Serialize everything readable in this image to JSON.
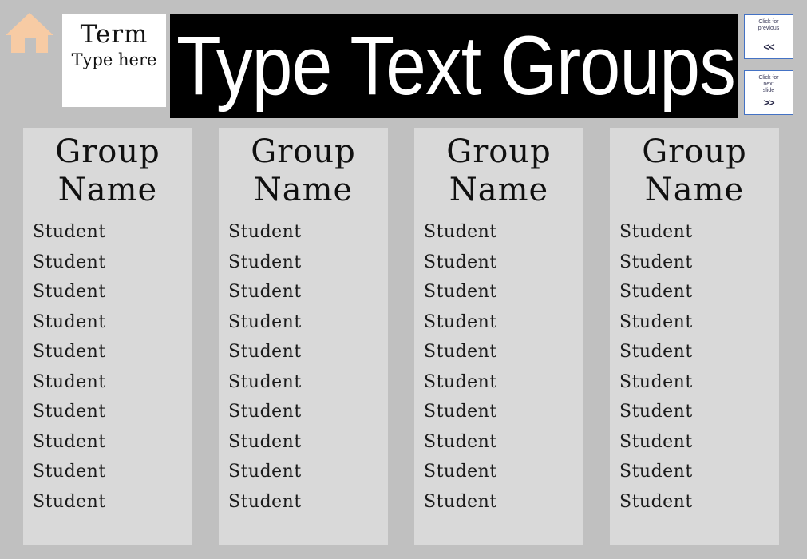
{
  "page": {
    "background_color": "#c0c0c0",
    "panel_color": "#d9d9d9"
  },
  "header": {
    "home_icon": "home-icon",
    "home_icon_color": "#f7cba4",
    "term_box": {
      "title": "Term",
      "hint": "Type\nhere"
    },
    "title": "Type Text Groups",
    "title_background": "#000000",
    "title_color": "#ffffff"
  },
  "nav": {
    "border_color": "#4472c4",
    "buttons": [
      {
        "name": "previous",
        "label": "Click for\nprevious",
        "arrow": "<<"
      },
      {
        "name": "next",
        "label": "Click for\nnext\nslide",
        "arrow": ">>"
      }
    ]
  },
  "groups": [
    {
      "name": "Group\nName",
      "students": [
        "Student",
        "Student",
        "Student",
        "Student",
        "Student",
        "Student",
        "Student",
        "Student",
        "Student",
        "Student"
      ]
    },
    {
      "name": "Group\nName",
      "students": [
        "Student",
        "Student",
        "Student",
        "Student",
        "Student",
        "Student",
        "Student",
        "Student",
        "Student",
        "Student"
      ]
    },
    {
      "name": "Group\nName",
      "students": [
        "Student",
        "Student",
        "Student",
        "Student",
        "Student",
        "Student",
        "Student",
        "Student",
        "Student",
        "Student"
      ]
    },
    {
      "name": "Group\nName",
      "students": [
        "Student",
        "Student",
        "Student",
        "Student",
        "Student",
        "Student",
        "Student",
        "Student",
        "Student",
        "Student"
      ]
    }
  ]
}
